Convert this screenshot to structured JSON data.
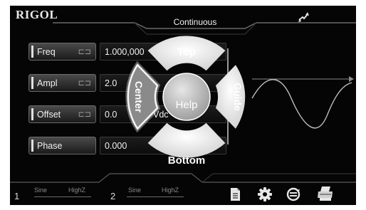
{
  "header": {
    "brand": "RIGOL",
    "mode": "Continuous",
    "sync_icon": "sync-arrows-icon"
  },
  "params": [
    {
      "label": "Freq",
      "value": "1.000,000",
      "link_icon": "link-icon"
    },
    {
      "label": "Ampl",
      "value": "2.0",
      "link_icon": "link-icon"
    },
    {
      "label": "Offset",
      "value": "0.0",
      "extra": "Vdc",
      "link_icon": "link-icon"
    },
    {
      "label": "Phase",
      "value": "0.000"
    }
  ],
  "channels": [
    {
      "num": "1",
      "wave": "Sine",
      "load": "HighZ"
    },
    {
      "num": "2",
      "wave": "Sine",
      "load": "HighZ"
    }
  ],
  "gesture_menu": {
    "top": "Top",
    "center": "Center",
    "help": "Help",
    "guide": "Guide",
    "bottom": "Bottom"
  },
  "toolbar_icons": [
    "file-icon",
    "gear-icon",
    "refresh-icon",
    "printer-icon"
  ],
  "colors": {
    "menu_white": "#ffffff",
    "background": "#050505",
    "accent_grey": "#cfcfcf"
  }
}
